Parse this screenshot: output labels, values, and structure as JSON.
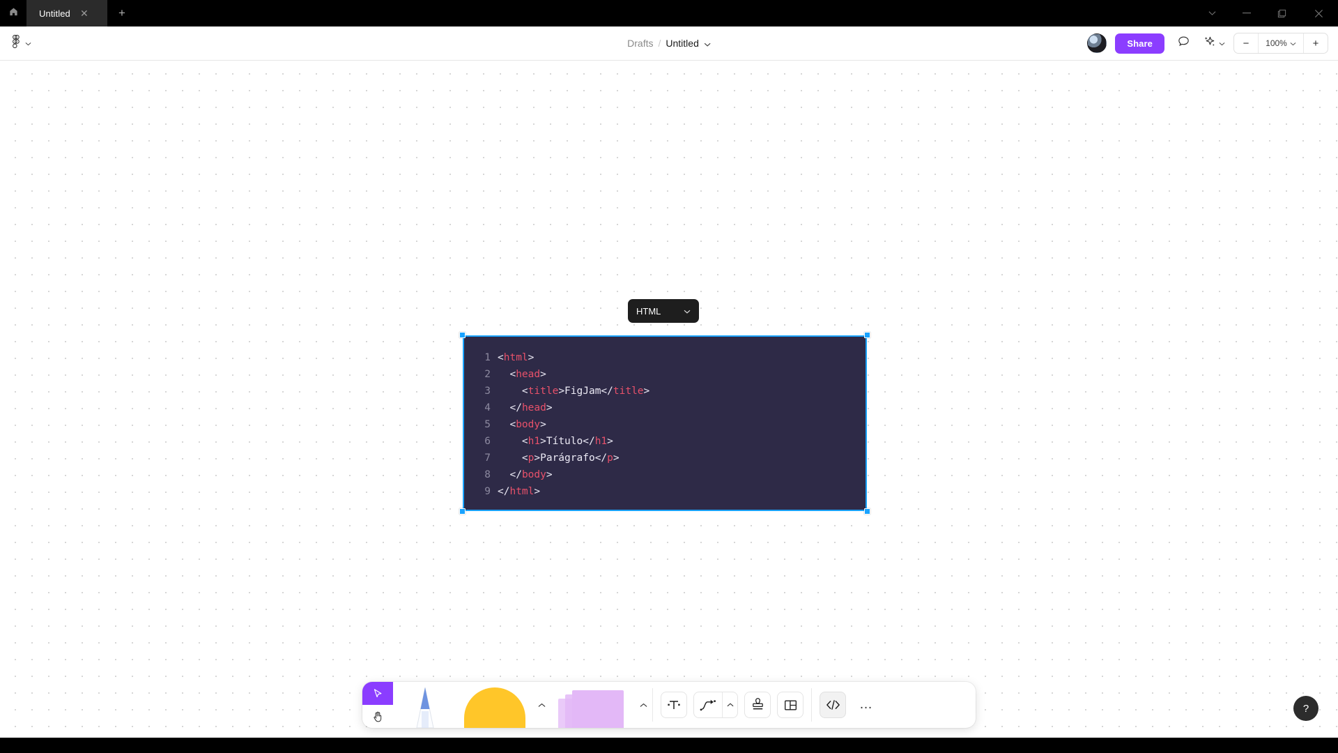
{
  "titlebar": {
    "home_icon": "home-icon",
    "tab_label": "Untitled",
    "tab_close_glyph": "✕",
    "new_tab_glyph": "+",
    "window_controls": {
      "chevron_glyph": "⌄",
      "minimize_glyph": "—",
      "maximize_glyph": "❐",
      "close_glyph": "✕"
    }
  },
  "toolbar": {
    "menu_icon": "figma-logo-icon",
    "menu_chevron": "⌄",
    "breadcrumb": {
      "folder": "Drafts",
      "separator": "/",
      "file": "Untitled",
      "chevron": "⌄"
    },
    "avatar_label": "user-avatar",
    "share_label": "Share",
    "comment_icon": "comment-bubble-icon",
    "ai_icon": "ai-sparkle-icon",
    "ai_chevron": "⌄",
    "zoom": {
      "minus": "−",
      "value": "100%",
      "chevron": "⌄",
      "plus": "+"
    }
  },
  "canvas": {
    "language_selector": {
      "label": "HTML",
      "chevron": "⌄"
    },
    "code_block": {
      "selected": true,
      "background_color": "#2E2A47",
      "selection_color": "#1aa3ff",
      "tag_color": "#e8516a",
      "text_color": "#eceaf5",
      "linenumber_color": "#8d8aa0",
      "lines": [
        {
          "n": "1",
          "indent": 0,
          "segments": [
            {
              "t": "<",
              "k": "txt"
            },
            {
              "t": "html",
              "k": "tag"
            },
            {
              "t": ">",
              "k": "txt"
            }
          ]
        },
        {
          "n": "2",
          "indent": 1,
          "segments": [
            {
              "t": "<",
              "k": "txt"
            },
            {
              "t": "head",
              "k": "tag"
            },
            {
              "t": ">",
              "k": "txt"
            }
          ]
        },
        {
          "n": "3",
          "indent": 2,
          "segments": [
            {
              "t": "<",
              "k": "txt"
            },
            {
              "t": "title",
              "k": "tag"
            },
            {
              "t": ">FigJam</",
              "k": "txt"
            },
            {
              "t": "title",
              "k": "tag"
            },
            {
              "t": ">",
              "k": "txt"
            }
          ]
        },
        {
          "n": "4",
          "indent": 1,
          "segments": [
            {
              "t": "</",
              "k": "txt"
            },
            {
              "t": "head",
              "k": "tag"
            },
            {
              "t": ">",
              "k": "txt"
            }
          ]
        },
        {
          "n": "5",
          "indent": 1,
          "segments": [
            {
              "t": "<",
              "k": "txt"
            },
            {
              "t": "body",
              "k": "tag"
            },
            {
              "t": ">",
              "k": "txt"
            }
          ]
        },
        {
          "n": "6",
          "indent": 2,
          "segments": [
            {
              "t": "<",
              "k": "txt"
            },
            {
              "t": "h1",
              "k": "tag"
            },
            {
              "t": ">Título</",
              "k": "txt"
            },
            {
              "t": "h1",
              "k": "tag"
            },
            {
              "t": ">",
              "k": "txt"
            }
          ]
        },
        {
          "n": "7",
          "indent": 2,
          "segments": [
            {
              "t": "<",
              "k": "txt"
            },
            {
              "t": "p",
              "k": "tag"
            },
            {
              "t": ">Parágrafo</",
              "k": "txt"
            },
            {
              "t": "p",
              "k": "tag"
            },
            {
              "t": ">",
              "k": "txt"
            }
          ]
        },
        {
          "n": "8",
          "indent": 1,
          "segments": [
            {
              "t": "</",
              "k": "txt"
            },
            {
              "t": "body",
              "k": "tag"
            },
            {
              "t": ">",
              "k": "txt"
            }
          ]
        },
        {
          "n": "9",
          "indent": 0,
          "segments": [
            {
              "t": "</",
              "k": "txt"
            },
            {
              "t": "html",
              "k": "tag"
            },
            {
              "t": ">",
              "k": "txt"
            }
          ]
        }
      ]
    }
  },
  "bottom_toolbar": {
    "select_tool": {
      "name": "cursor-select-tool",
      "active": true,
      "accent": "#8b3dff"
    },
    "hand_tool": {
      "name": "hand-tool",
      "active": false
    },
    "pen_tool": {
      "name": "marker-pen-tool"
    },
    "shape_tool": {
      "name": "shape-tool",
      "color": "#FFC629"
    },
    "shape_chevron": "⌃",
    "sticky_tool": {
      "name": "sticky-note-tool",
      "color": "#E3B8F7"
    },
    "sticky_chevron": "⌃",
    "text_tool": {
      "name": "text-tool",
      "glyph": "T"
    },
    "connector_tool": {
      "name": "connector-tool"
    },
    "connector_chevron": "⌃",
    "stamp_tool": {
      "name": "stamp-tool"
    },
    "template_tool": {
      "name": "template-tool"
    },
    "code_block_tool": {
      "name": "code-block-tool",
      "glyph": "</>",
      "active": true
    },
    "more_tool": {
      "name": "more-tools",
      "glyph": "…"
    }
  },
  "help": {
    "glyph": "?"
  }
}
